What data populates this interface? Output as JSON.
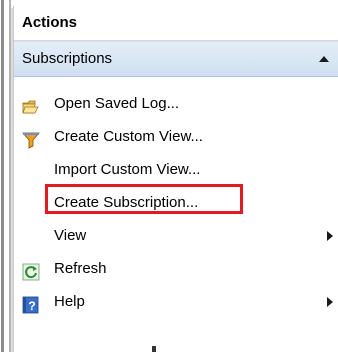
{
  "panel": {
    "title": "Actions",
    "group": "Subscriptions"
  },
  "menu": {
    "items": [
      {
        "label": "Open Saved Log...",
        "icon": "folder-icon"
      },
      {
        "label": "Create Custom View...",
        "icon": "filter-icon"
      },
      {
        "label": "Import Custom View...",
        "icon": ""
      },
      {
        "label": "Create Subscription...",
        "icon": ""
      },
      {
        "label": "View",
        "icon": "",
        "submenu": true
      },
      {
        "label": "Refresh",
        "icon": "refresh-icon"
      },
      {
        "label": "Help",
        "icon": "help-icon",
        "submenu": true
      }
    ]
  },
  "colors": {
    "group_header_top": "#e5eef8",
    "group_header_bottom": "#cfdff0",
    "highlight_box": "#e01b24"
  }
}
